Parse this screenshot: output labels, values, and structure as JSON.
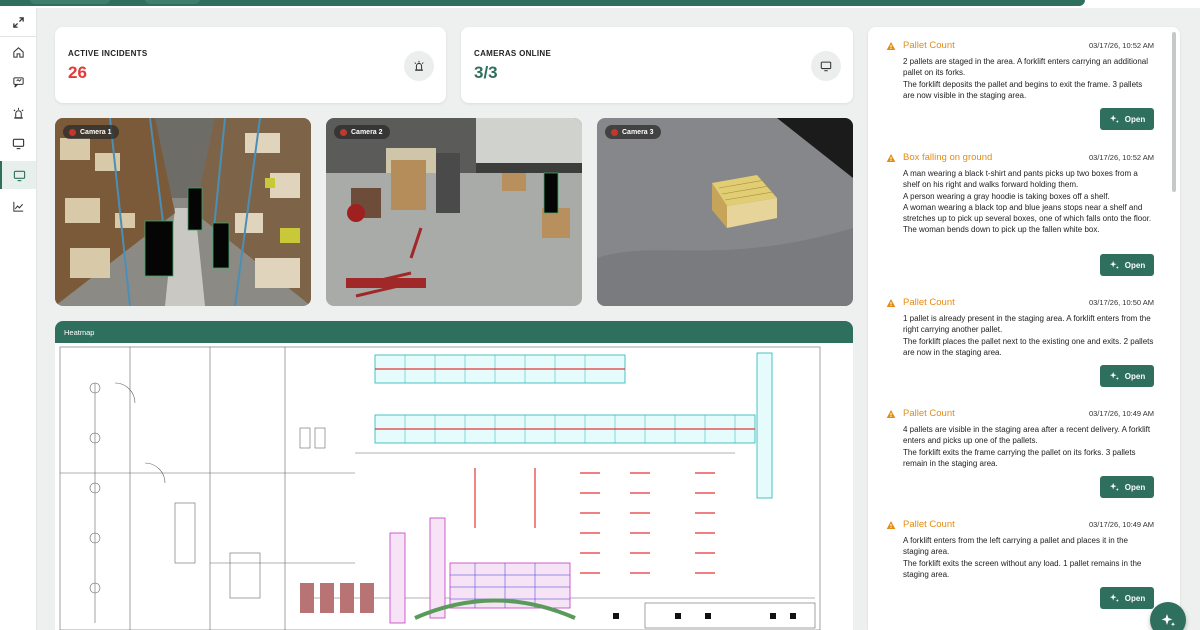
{
  "colors": {
    "brand_green": "#2f6f5e",
    "incident_red": "#e53935",
    "online_green": "#2f6f5e",
    "alert_orange": "#e48b14"
  },
  "sidebar": {
    "items": [
      {
        "icon": "expand-icon",
        "active": false
      },
      {
        "icon": "home-icon",
        "active": false
      },
      {
        "icon": "chat-icon",
        "active": false
      },
      {
        "icon": "siren-icon",
        "active": false
      },
      {
        "icon": "monitor-icon",
        "active": false
      },
      {
        "icon": "monitor-icon",
        "active": true
      },
      {
        "icon": "chart-line-icon",
        "active": false
      }
    ]
  },
  "stats": {
    "incidents": {
      "label": "ACTIVE INCIDENTS",
      "value": "26",
      "icon": "siren-icon"
    },
    "cameras": {
      "label": "CAMERAS ONLINE",
      "value": "3/3",
      "icon": "monitor-icon"
    }
  },
  "cameras": [
    {
      "label": "Camera 1",
      "status": "recording"
    },
    {
      "label": "Camera 2",
      "status": "recording"
    },
    {
      "label": "Camera 3",
      "status": "recording"
    }
  ],
  "heatmap": {
    "title": "Heatmap"
  },
  "alerts": [
    {
      "title": "Pallet Count",
      "time": "03/17/26, 10:52 AM",
      "lines": [
        "2 pallets are staged in the area. A forklift enters carrying an additional pallet on its forks.",
        "The forklift deposits the pallet and begins to exit the frame. 3 pallets are now visible in the staging area."
      ],
      "button": "Open"
    },
    {
      "title": "Box falling on ground",
      "time": "03/17/26, 10:52 AM",
      "lines": [
        "A man wearing a black t-shirt and pants picks up two boxes from a shelf on his right and walks forward holding them.",
        "A person wearing a gray hoodie is taking boxes off a shelf.",
        "A woman wearing a black top and blue jeans stops near a shelf and stretches up to pick up several boxes, one of which falls onto the floor.",
        "The woman bends down to pick up the fallen white box."
      ],
      "button": "Open"
    },
    {
      "title": "Pallet Count",
      "time": "03/17/26, 10:50 AM",
      "lines": [
        "1 pallet is already present in the staging area. A forklift enters from the right carrying another pallet.",
        "The forklift places the pallet next to the existing one and exits. 2 pallets are now in the staging area."
      ],
      "button": "Open"
    },
    {
      "title": "Pallet Count",
      "time": "03/17/26, 10:49 AM",
      "lines": [
        "4 pallets are visible in the staging area after a recent delivery. A forklift enters and picks up one of the pallets.",
        "The forklift exits the frame carrying the pallet on its forks. 3 pallets remain in the staging area."
      ],
      "button": "Open"
    },
    {
      "title": "Pallet Count",
      "time": "03/17/26, 10:49 AM",
      "lines": [
        "A forklift enters from the left carrying a pallet and places it in the staging area.",
        "The forklift exits the screen without any load. 1 pallet remains in the staging area."
      ],
      "button": "Open"
    }
  ],
  "fab": {
    "icon": "sparkle-icon"
  }
}
